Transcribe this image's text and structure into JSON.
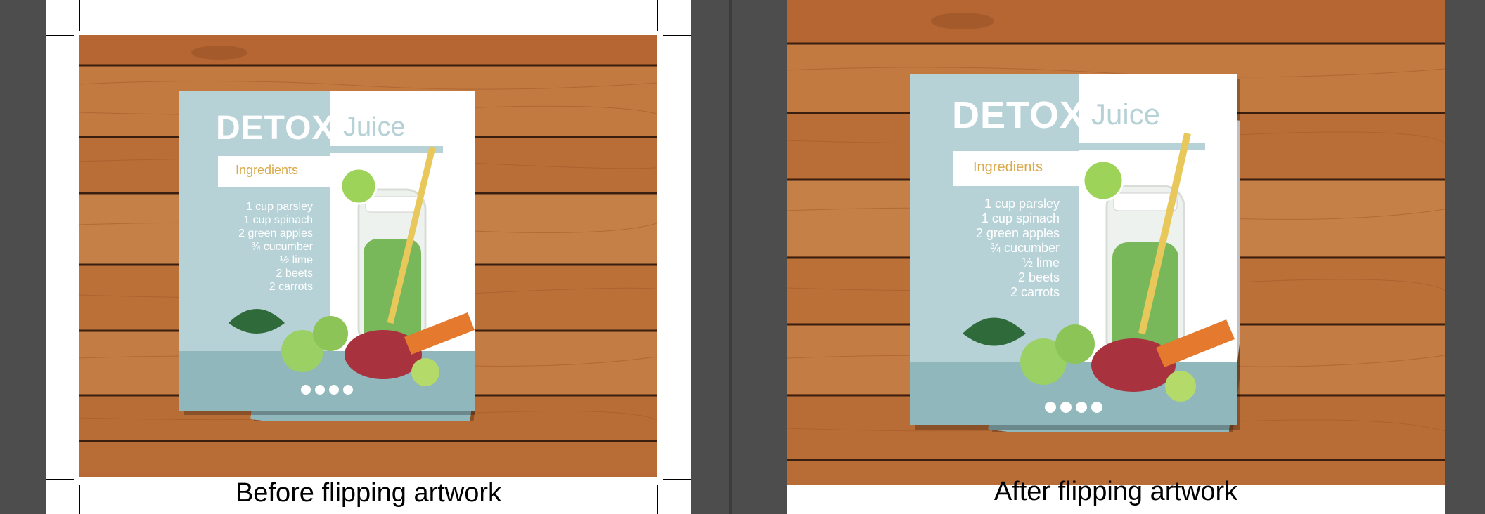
{
  "before_panel": {
    "caption": "Before flipping artwork"
  },
  "after_panel": {
    "caption": "After flipping artwork"
  },
  "flyer": {
    "title_word1": "DETOX",
    "title_word2": "Juice",
    "ingredients_heading": "Ingredients",
    "ingredients": [
      "1 cup parsley",
      "1 cup spinach",
      "2 green apples",
      "¾ cucumber",
      "½ lime",
      "2 beets",
      "2 carrots"
    ],
    "social_icons": [
      "facebook-icon",
      "instagram-icon",
      "twitter-icon",
      "pinterest-icon"
    ]
  },
  "colors": {
    "wood_base": "#b86a35",
    "wood_light": "#c98145",
    "wood_dark": "#3a1f10",
    "flyer_teal": "#b6d2d6",
    "flyer_teal_dark": "#8fb7bc",
    "ingredients_gold": "#d9a94a",
    "juice_green": "#79b85a",
    "background_gray": "#4d4d4d"
  }
}
